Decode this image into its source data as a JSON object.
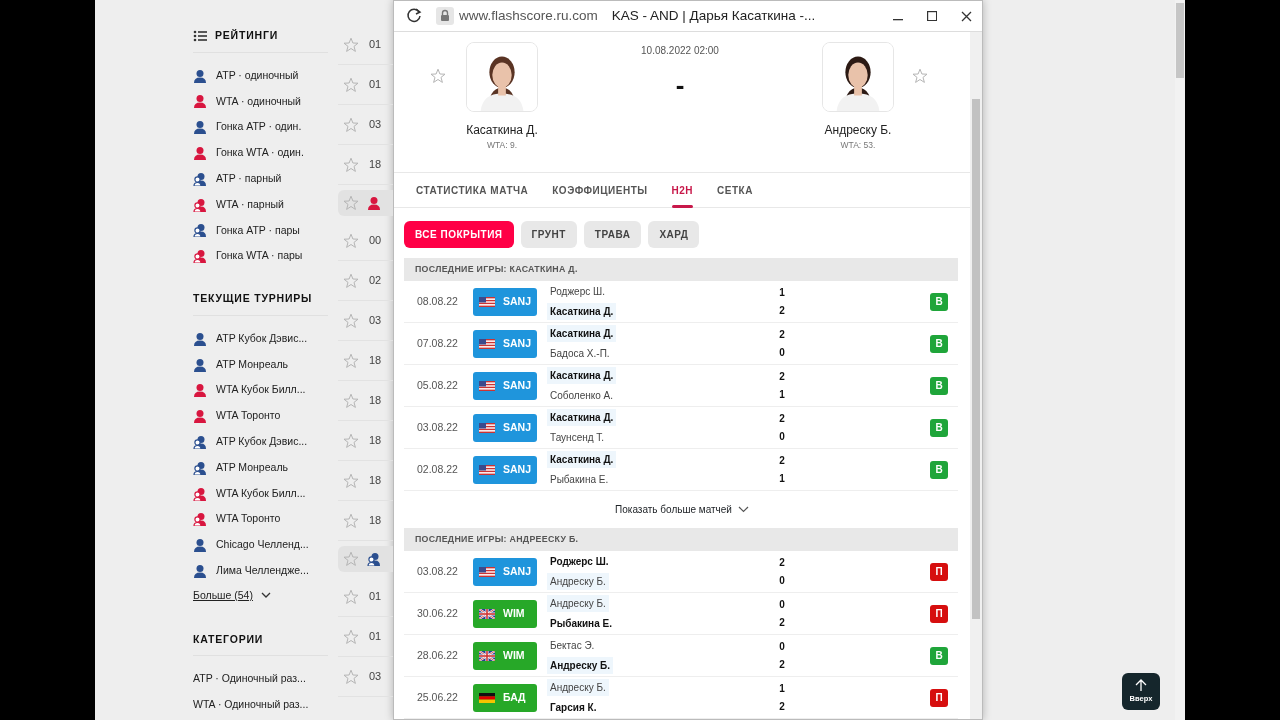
{
  "sidebar": {
    "sections": [
      {
        "title": "РЕЙТИНГИ",
        "items": [
          {
            "label": "ATP · одиночный",
            "kind": "single",
            "color": "#2b4f8f"
          },
          {
            "label": "WTA · одиночный",
            "kind": "single",
            "color": "#d8163f"
          },
          {
            "label": "Гонка ATP · один.",
            "kind": "single",
            "color": "#2b4f8f"
          },
          {
            "label": "Гонка WTA · один.",
            "kind": "single",
            "color": "#d8163f"
          },
          {
            "label": "ATP · парный",
            "kind": "double",
            "color": "#2b4f8f"
          },
          {
            "label": "WTA · парный",
            "kind": "double",
            "color": "#d8163f"
          },
          {
            "label": "Гонка ATP · пары",
            "kind": "double",
            "color": "#2b4f8f"
          },
          {
            "label": "Гонка WTA · пары",
            "kind": "double",
            "color": "#d8163f"
          }
        ]
      },
      {
        "title": "ТЕКУЩИЕ ТУРНИРЫ",
        "items": [
          {
            "label": "ATP Кубок Дэвис...",
            "kind": "single",
            "color": "#2b4f8f"
          },
          {
            "label": "ATP Монреаль",
            "kind": "single",
            "color": "#2b4f8f"
          },
          {
            "label": "WTA Кубок Билл...",
            "kind": "single",
            "color": "#d8163f"
          },
          {
            "label": "WTA Торонто",
            "kind": "single",
            "color": "#d8163f"
          },
          {
            "label": "ATP Кубок Дэвис...",
            "kind": "double",
            "color": "#2b4f8f"
          },
          {
            "label": "ATP Монреаль",
            "kind": "double",
            "color": "#2b4f8f"
          },
          {
            "label": "WTA Кубок Билл...",
            "kind": "double",
            "color": "#d8163f"
          },
          {
            "label": "WTA Торонто",
            "kind": "double",
            "color": "#d8163f"
          },
          {
            "label": "Chicago Челленд...",
            "kind": "single",
            "color": "#2b4f8f"
          },
          {
            "label": "Лима Челлендже...",
            "kind": "single",
            "color": "#2b4f8f"
          }
        ],
        "more": "Больше (54)"
      },
      {
        "title": "КАТЕГОРИИ",
        "items": [
          {
            "label": "ATP · Одиночный раз...",
            "kind": "plain"
          },
          {
            "label": "WTA · Одиночный раз...",
            "kind": "plain"
          }
        ]
      }
    ]
  },
  "match_list": {
    "rows": [
      {
        "kind": "match",
        "time": "01"
      },
      {
        "kind": "match",
        "time": "01"
      },
      {
        "kind": "match",
        "time": "03"
      },
      {
        "kind": "match",
        "time": "18"
      },
      {
        "kind": "group_single",
        "color": "#d8163f"
      },
      {
        "kind": "match",
        "time": "00"
      },
      {
        "kind": "match",
        "time": "02"
      },
      {
        "kind": "match",
        "time": "03"
      },
      {
        "kind": "match",
        "time": "18"
      },
      {
        "kind": "match",
        "time": "18"
      },
      {
        "kind": "match",
        "time": "18"
      },
      {
        "kind": "match",
        "time": "18"
      },
      {
        "kind": "match",
        "time": "18"
      },
      {
        "kind": "group_double",
        "color": "#2b4f8f"
      },
      {
        "kind": "match",
        "time": "01"
      },
      {
        "kind": "match",
        "time": "01"
      },
      {
        "kind": "match",
        "time": "03"
      }
    ]
  },
  "popup": {
    "url": "www.flashscore.ru.com",
    "title": "KAS - AND | Дарья Касаткина -...",
    "home": {
      "name": "Касаткина Д.",
      "rank": "WTA: 9."
    },
    "away": {
      "name": "Андреску Б.",
      "rank": "WTA: 53."
    },
    "date": "10.08.2022 02:00",
    "score": "-",
    "tabs": [
      {
        "label": "СТАТИСТИКА МАТЧА",
        "selected": false
      },
      {
        "label": "КОЭФФИЦИЕНТЫ",
        "selected": false
      },
      {
        "label": "H2H",
        "selected": true
      },
      {
        "label": "СЕТКА",
        "selected": false
      }
    ],
    "filters": [
      {
        "label": "ВСЕ ПОКРЫТИЯ",
        "selected": true
      },
      {
        "label": "ГРУНТ",
        "selected": false
      },
      {
        "label": "ТРАВА",
        "selected": false
      },
      {
        "label": "ХАРД",
        "selected": false
      }
    ],
    "sections": [
      {
        "title": "ПОСЛЕДНИЕ ИГРЫ: КАСАТКИНА Д.",
        "more": "Показать больше матчей",
        "rows": [
          {
            "date": "08.08.22",
            "event": {
              "code": "SANJ",
              "kind": "us",
              "color": "#1f95dc"
            },
            "players": [
              {
                "name": "Роджерс Ш.",
                "score": "1",
                "winner": false,
                "focus": false
              },
              {
                "name": "Касаткина Д.",
                "score": "2",
                "winner": true,
                "focus": true
              }
            ],
            "result": {
              "label": "В",
              "kind": "win"
            }
          },
          {
            "date": "07.08.22",
            "event": {
              "code": "SANJ",
              "kind": "us",
              "color": "#1f95dc"
            },
            "players": [
              {
                "name": "Касаткина Д.",
                "score": "2",
                "winner": true,
                "focus": true
              },
              {
                "name": "Бадоса Х.-П.",
                "score": "0",
                "winner": false,
                "focus": false
              }
            ],
            "result": {
              "label": "В",
              "kind": "win"
            }
          },
          {
            "date": "05.08.22",
            "event": {
              "code": "SANJ",
              "kind": "us",
              "color": "#1f95dc"
            },
            "players": [
              {
                "name": "Касаткина Д.",
                "score": "2",
                "winner": true,
                "focus": true
              },
              {
                "name": "Соболенко А.",
                "score": "1",
                "winner": false,
                "focus": false
              }
            ],
            "result": {
              "label": "В",
              "kind": "win"
            }
          },
          {
            "date": "03.08.22",
            "event": {
              "code": "SANJ",
              "kind": "us",
              "color": "#1f95dc"
            },
            "players": [
              {
                "name": "Касаткина Д.",
                "score": "2",
                "winner": true,
                "focus": true
              },
              {
                "name": "Таунсенд Т.",
                "score": "0",
                "winner": false,
                "focus": false
              }
            ],
            "result": {
              "label": "В",
              "kind": "win"
            }
          },
          {
            "date": "02.08.22",
            "event": {
              "code": "SANJ",
              "kind": "us",
              "color": "#1f95dc"
            },
            "players": [
              {
                "name": "Касаткина Д.",
                "score": "2",
                "winner": true,
                "focus": true
              },
              {
                "name": "Рыбакина Е.",
                "score": "1",
                "winner": false,
                "focus": false
              }
            ],
            "result": {
              "label": "В",
              "kind": "win"
            }
          }
        ]
      },
      {
        "title": "ПОСЛЕДНИЕ ИГРЫ: АНДРЕЕСКУ Б.",
        "rows": [
          {
            "date": "03.08.22",
            "event": {
              "code": "SANJ",
              "kind": "us",
              "color": "#1f95dc"
            },
            "players": [
              {
                "name": "Роджерс Ш.",
                "score": "2",
                "winner": true,
                "focus": false
              },
              {
                "name": "Андреску Б.",
                "score": "0",
                "winner": false,
                "focus": true
              }
            ],
            "result": {
              "label": "П",
              "kind": "loss"
            }
          },
          {
            "date": "30.06.22",
            "event": {
              "code": "WIM",
              "kind": "gb",
              "color": "#27a828"
            },
            "players": [
              {
                "name": "Андреску Б.",
                "score": "0",
                "winner": false,
                "focus": true
              },
              {
                "name": "Рыбакина Е.",
                "score": "2",
                "winner": true,
                "focus": false
              }
            ],
            "result": {
              "label": "П",
              "kind": "loss"
            }
          },
          {
            "date": "28.06.22",
            "event": {
              "code": "WIM",
              "kind": "gb",
              "color": "#27a828"
            },
            "players": [
              {
                "name": "Бектас Э.",
                "score": "0",
                "winner": false,
                "focus": false
              },
              {
                "name": "Андреску Б.",
                "score": "2",
                "winner": true,
                "focus": true
              }
            ],
            "result": {
              "label": "В",
              "kind": "win"
            }
          },
          {
            "date": "25.06.22",
            "event": {
              "code": "БАД",
              "kind": "de",
              "color": "#27a828"
            },
            "players": [
              {
                "name": "Андреску Б.",
                "score": "1",
                "winner": false,
                "focus": true
              },
              {
                "name": "Гарсия К.",
                "score": "2",
                "winner": true,
                "focus": false
              }
            ],
            "result": {
              "label": "П",
              "kind": "loss"
            }
          }
        ]
      }
    ]
  },
  "scroll_top_button": {
    "label": "Вверх"
  }
}
